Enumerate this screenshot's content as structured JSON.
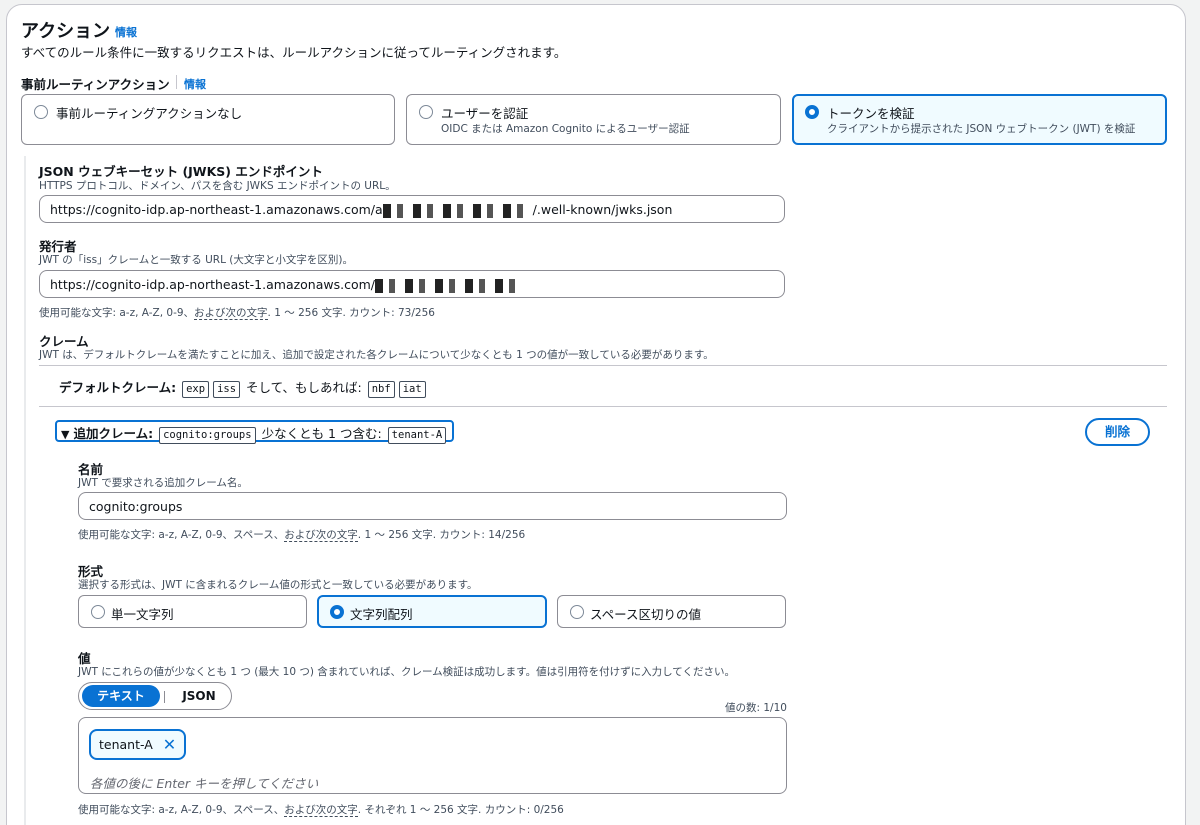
{
  "header": {
    "title": "アクション",
    "info": "情報",
    "description": "すべてのルール条件に一致するリクエストは、ルールアクションに従ってルーティングされます。"
  },
  "pre_routing": {
    "label": "事前ルーティンアクション",
    "info": "情報",
    "options": [
      {
        "title": "事前ルーティングアクションなし",
        "desc": "",
        "selected": false
      },
      {
        "title": "ユーザーを認証",
        "desc": "OIDC または Amazon Cognito によるユーザー認証",
        "selected": false
      },
      {
        "title": "トークンを検証",
        "desc": "クライアントから提示された JSON ウェブトークン (JWT) を検証",
        "selected": true
      }
    ]
  },
  "jwks": {
    "label": "JSON ウェブキーセット (JWKS) エンドポイント",
    "desc": "HTTPS プロトコル、ドメイン、パスを含む JWKS エンドポイントの URL。",
    "value_prefix": "https://cognito-idp.ap-northeast-1.amazonaws.com/a",
    "value_suffix": "/.well-known/jwks.json"
  },
  "issuer": {
    "label": "発行者",
    "desc": "JWT の「iss」クレームと一致する URL (大文字と小文字を区別)。",
    "value_prefix": "https://cognito-idp.ap-northeast-1.amazonaws.com/",
    "hint_prefix": "使用可能な文字: a-z, A-Z, 0-9、",
    "hint_link": "および次の文字",
    "hint_suffix": ". 1 〜 256 文字. カウント: 73/256"
  },
  "claims": {
    "label": "クレーム",
    "desc": "JWT は、デフォルトクレームを満たすことに加え、追加で設定された各クレームについて少なくとも 1 つの値が一致している必要があります。",
    "default_label": "デフォルトクレーム:",
    "default_codes": [
      "exp",
      "iss"
    ],
    "default_mid": "そして、もしあれば:",
    "optional_codes": [
      "nbf",
      "iat"
    ]
  },
  "additional": {
    "label": "追加クレーム:",
    "claim_code": "cognito:groups",
    "mid": "少なくとも 1 つ含む:",
    "value_code": "tenant-A",
    "delete_label": "削除",
    "name": {
      "label": "名前",
      "desc": "JWT で要求される追加クレーム名。",
      "value": "cognito:groups",
      "hint_prefix": "使用可能な文字: a-z, A-Z, 0-9、スペース、",
      "hint_link": "および次の文字",
      "hint_suffix": ". 1 〜 256 文字. カウント: 14/256"
    },
    "format": {
      "label": "形式",
      "desc": "選択する形式は、JWT に含まれるクレーム値の形式と一致している必要があります。",
      "options": [
        {
          "title": "単一文字列",
          "selected": false
        },
        {
          "title": "文字列配列",
          "selected": true
        },
        {
          "title": "スペース区切りの値",
          "selected": false
        }
      ]
    },
    "values": {
      "label": "値",
      "desc": "JWT にこれらの値が少なくとも 1 つ (最大 10 つ) 含まれていれば、クレーム検証は成功します。値は引用符を付けずに入力してください。",
      "tab_text": "テキスト",
      "tab_json": "JSON",
      "count": "値の数: 1/10",
      "tokens": [
        "tenant-A"
      ],
      "placeholder": "各値の後に Enter キーを押してください",
      "hint_prefix": "使用可能な文字: a-z, A-Z, 0-9、スペース、",
      "hint_link": "および次の文字",
      "hint_suffix": ". それぞれ 1 〜 256 文字. カウント: 0/256"
    }
  },
  "colors": {
    "accent": "#0972d3",
    "selected_bg": "#f0fbff"
  }
}
